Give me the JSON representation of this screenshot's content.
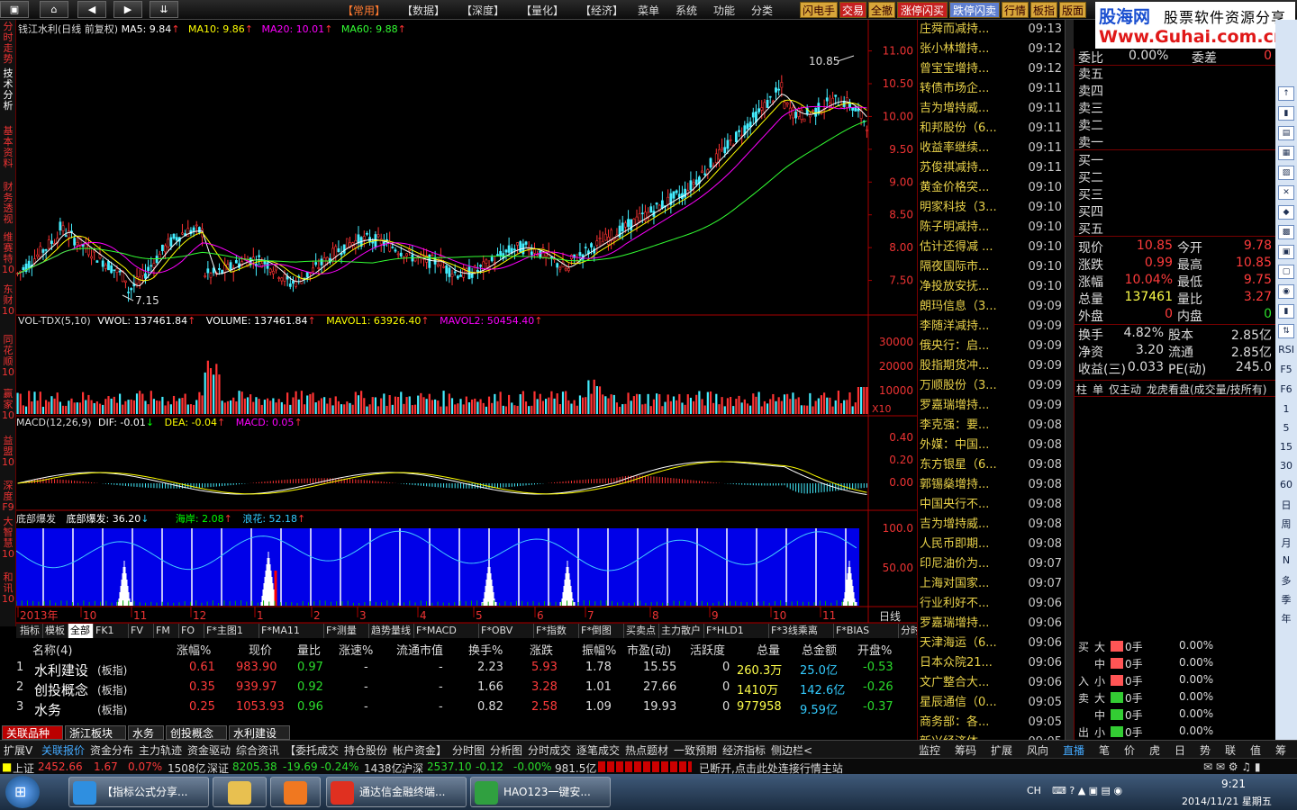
{
  "topbar": {
    "menu": [
      "【常用】",
      "【数据】",
      "【深度】",
      "【量化】",
      "【经济】",
      "菜单",
      "系统",
      "功能",
      "分类"
    ],
    "quick": [
      "闪电手",
      "交易",
      "全撤",
      "涨停闪买",
      "跌停闪卖",
      "行情",
      "板指",
      "版面"
    ]
  },
  "brand": {
    "name": "股海网",
    "slogan": "股票软件资源分享",
    "url": "Www.Guhai.com.cn"
  },
  "left_tabs": [
    "分时走势",
    "技术分析",
    "基本资料",
    "财务透视",
    "维赛特10",
    "东财10",
    "同花顺10",
    "赢家10",
    "益盟10",
    "深度F9",
    "大智慧10",
    "和讯10"
  ],
  "chart": {
    "title": "钱江水利(日线 前复权)",
    "ma5": "MA5: 9.84",
    "ma10": "MA10: 9.86",
    "ma20": "MA20: 10.01",
    "ma60": "MA60: 9.88",
    "price_axis": [
      "11.00",
      "10.50",
      "10.00",
      "9.50",
      "9.00",
      "8.50",
      "8.00",
      "7.50"
    ],
    "high_label": "10.85",
    "low_label": "7.15",
    "vol_title": "VOL-TDX(5,10)",
    "vwol": "VWOL: 137461.84",
    "volume": "VOLUME: 137461.84",
    "mavol1": "MAVOL1: 63926.40",
    "mavol2": "MAVOL2: 50454.40",
    "vol_axis": [
      "30000",
      "20000",
      "10000"
    ],
    "vol_unit": "X10",
    "macd_title": "MACD(12,26,9)",
    "dif": "DIF: -0.01",
    "dea": "DEA: -0.04",
    "macd": "MACD: 0.05",
    "macd_axis": [
      "0.40",
      "0.20",
      "0.00"
    ],
    "ind_title": "底部爆发",
    "ind1": "底部爆发: 36.20",
    "ind2": "海岸: 2.08",
    "ind3": "浪花: 52.18",
    "ind_axis": [
      "100.0",
      "50.00"
    ],
    "xaxis": [
      "2013年",
      "10",
      "11",
      "12",
      "1",
      "2",
      "3",
      "4",
      "5",
      "6",
      "7",
      "8",
      "9",
      "10",
      "11"
    ],
    "period": "日线"
  },
  "panel_tabs": [
    "指标",
    "模板",
    "全部",
    "FK1",
    "FV",
    "FM",
    "FO",
    "F*主图1",
    "F*MA11",
    "F*测量",
    "趋势量线",
    "F*MACD",
    "F*OBV",
    "F*指数",
    "F*倒图",
    "买卖点",
    "主力散户",
    "F*HLD1",
    "F*3线乘离",
    "F*BIAS",
    "分时买卖",
    "分时涨停"
  ],
  "table": {
    "headers": [
      "名称(4)",
      "涨幅%",
      "现价",
      "量比",
      "涨速%",
      "流通市值",
      "换手%",
      "涨跌",
      "振幅%",
      "市盈(动)",
      "活跃度",
      "总量",
      "总金额",
      "开盘%"
    ],
    "rows": [
      {
        "idx": "1",
        "name": "水利建设",
        "tag": "(板指)",
        "chg": "0.61",
        "price": "983.90",
        "lb": "0.97",
        "spd": "-",
        "mv": "-",
        "turn": "2.23",
        "diff": "5.93",
        "amp": "1.78",
        "pe": "15.55",
        "act": "0",
        "vol": "260.3万",
        "amt": "25.0亿",
        "open": "-0.53"
      },
      {
        "idx": "2",
        "name": "创投概念",
        "tag": "(板指)",
        "chg": "0.35",
        "price": "939.97",
        "lb": "0.92",
        "spd": "-",
        "mv": "-",
        "turn": "1.66",
        "diff": "3.28",
        "amp": "1.01",
        "pe": "27.66",
        "act": "0",
        "vol": "1410万",
        "amt": "142.6亿",
        "open": "-0.26"
      },
      {
        "idx": "3",
        "name": "水务",
        "tag": "(板指)",
        "chg": "0.25",
        "price": "1053.93",
        "lb": "0.96",
        "spd": "-",
        "mv": "-",
        "turn": "0.82",
        "diff": "2.58",
        "amp": "1.09",
        "pe": "19.93",
        "act": "0",
        "vol": "977958",
        "amt": "9.59亿",
        "open": "-0.37"
      }
    ]
  },
  "section_tabs": [
    "关联品种",
    "浙江板块",
    "水务",
    "创投概念",
    "水利建设"
  ],
  "news": [
    {
      "t": "庄舜而减持...",
      "tm": "09:13"
    },
    {
      "t": "张小林增持...",
      "tm": "09:12"
    },
    {
      "t": "曾宝宝增持...",
      "tm": "09:12"
    },
    {
      "t": "转债市场企...",
      "tm": "09:11"
    },
    {
      "t": "吉为增持威...",
      "tm": "09:11"
    },
    {
      "t": "和邦股份（6...",
      "tm": "09:11"
    },
    {
      "t": "收益率继续...",
      "tm": "09:11"
    },
    {
      "t": "苏俊祺减持...",
      "tm": "09:11"
    },
    {
      "t": "黄金价格突...",
      "tm": "09:10"
    },
    {
      "t": "明家科技（3...",
      "tm": "09:10"
    },
    {
      "t": "陈子明减持...",
      "tm": "09:10"
    },
    {
      "t": "估计还得减 ...",
      "tm": "09:10"
    },
    {
      "t": "隔夜国际市...",
      "tm": "09:10"
    },
    {
      "t": "净投放安抚...",
      "tm": "09:10"
    },
    {
      "t": "朗玛信息（3...",
      "tm": "09:09"
    },
    {
      "t": "李随洋减持...",
      "tm": "09:09"
    },
    {
      "t": "俄央行：启...",
      "tm": "09:09"
    },
    {
      "t": "股指期货冲...",
      "tm": "09:09"
    },
    {
      "t": "万顺股份（3...",
      "tm": "09:09"
    },
    {
      "t": "罗嘉瑞增持...",
      "tm": "09:09"
    },
    {
      "t": "李克强：要...",
      "tm": "09:08"
    },
    {
      "t": "外媒：中国...",
      "tm": "09:08"
    },
    {
      "t": "东方银星（6...",
      "tm": "09:08"
    },
    {
      "t": "郭锡燊增持...",
      "tm": "09:08"
    },
    {
      "t": "中国央行不...",
      "tm": "09:08"
    },
    {
      "t": "吉为增持威...",
      "tm": "09:08"
    },
    {
      "t": "人民币即期...",
      "tm": "09:08"
    },
    {
      "t": "印尼油价为...",
      "tm": "09:07"
    },
    {
      "t": "上海对国家...",
      "tm": "09:07"
    },
    {
      "t": "行业利好不...",
      "tm": "09:06"
    },
    {
      "t": "罗嘉瑞增持...",
      "tm": "09:06"
    },
    {
      "t": "天津海运（6...",
      "tm": "09:06"
    },
    {
      "t": "日本众院21...",
      "tm": "09:06"
    },
    {
      "t": "文广整合大...",
      "tm": "09:06"
    },
    {
      "t": "星辰通信（0...",
      "tm": "09:05"
    },
    {
      "t": "商务部：各...",
      "tm": "09:05"
    },
    {
      "t": "新兴经济体...",
      "tm": "09:05"
    }
  ],
  "quote": {
    "weibi_label": "委比",
    "weibi": "0.00%",
    "weicha_label": "委差",
    "weicha": "0",
    "sells": [
      "卖五",
      "卖四",
      "卖三",
      "卖二",
      "卖一"
    ],
    "buys": [
      "买一",
      "买二",
      "买三",
      "买四",
      "买五"
    ],
    "rows": [
      {
        "l1": "现价",
        "v1": "10.85",
        "l2": "今开",
        "v2": "9.78"
      },
      {
        "l1": "涨跌",
        "v1": "0.99",
        "l2": "最高",
        "v2": "10.85"
      },
      {
        "l1": "涨幅",
        "v1": "10.04%",
        "l2": "最低",
        "v2": "9.75"
      },
      {
        "l1": "总量",
        "v1": "137461",
        "l2": "量比",
        "v2": "3.27"
      },
      {
        "l1": "外盘",
        "v1": "0",
        "l2": "内盘",
        "v2": "0"
      }
    ],
    "rows2": [
      {
        "l1": "换手",
        "v1": "4.82%",
        "l2": "股本",
        "v2": "2.85亿"
      },
      {
        "l1": "净资",
        "v1": "3.20",
        "l2": "流通",
        "v2": "2.85亿"
      },
      {
        "l1": "收益(三)",
        "v1": "0.033",
        "l2": "PE(动)",
        "v2": "245.0"
      }
    ],
    "subtabs": [
      "柱",
      "单",
      "仅主动",
      "龙虎看盘(成交量/技所有)"
    ],
    "flow": [
      {
        "g": "买",
        "s": "大",
        "v": "0手",
        "p": "0.00%"
      },
      {
        "g": "",
        "s": "中",
        "v": "0手",
        "p": "0.00%"
      },
      {
        "g": "入",
        "s": "小",
        "v": "0手",
        "p": "0.00%"
      },
      {
        "g": "卖",
        "s": "大",
        "v": "0手",
        "p": "0.00%"
      },
      {
        "g": "",
        "s": "中",
        "v": "0手",
        "p": "0.00%"
      },
      {
        "g": "出",
        "s": "小",
        "v": "0手",
        "p": "0.00%"
      }
    ]
  },
  "right_tools": [
    "RSI",
    "F5",
    "F6",
    "1",
    "5",
    "15",
    "30",
    "60",
    "日",
    "周",
    "月",
    "N",
    "多",
    "季",
    "年"
  ],
  "bottom_tabs": [
    "扩展V",
    "关联报价",
    "资金分布",
    "主力轨迹",
    "资金驱动",
    "综合资讯",
    "【委托成交",
    "持仓股份",
    "帐户资金】",
    "分时图",
    "分析图",
    "分时成交",
    "逐笔成交",
    "热点题材",
    "一致预期",
    "经济指标",
    "侧边栏<"
  ],
  "bottom_tabs_right": [
    "监控",
    "筹码",
    "扩展",
    "风向",
    "直播",
    "笔",
    "价",
    "虎",
    "日",
    "势",
    "联",
    "值",
    "筹"
  ],
  "status": {
    "sh_label": "上证",
    "sh": "2452.66",
    "sh_chg": "1.67",
    "sh_pct": "0.07%",
    "sh_amt": "1508亿",
    "sz_label": "深证",
    "sz": "8205.38",
    "sz_chg": "-19.69",
    "sz_pct": "-0.24%",
    "sz_amt": "1438亿",
    "hs_label": "沪深",
    "hs": "2537.10",
    "hs_chg": "-0.12",
    "hs_pct": "-0.00%",
    "hs_amt": "981.5亿",
    "msg": "已断开,点击此处连接行情主站"
  },
  "taskbar": {
    "tasks": [
      "【指标公式分享...",
      "",
      "",
      "通达信金融终端...",
      "HAO123一键安..."
    ],
    "ime": "CH",
    "time": "9:21",
    "date": "2014/11/21 星期五"
  }
}
